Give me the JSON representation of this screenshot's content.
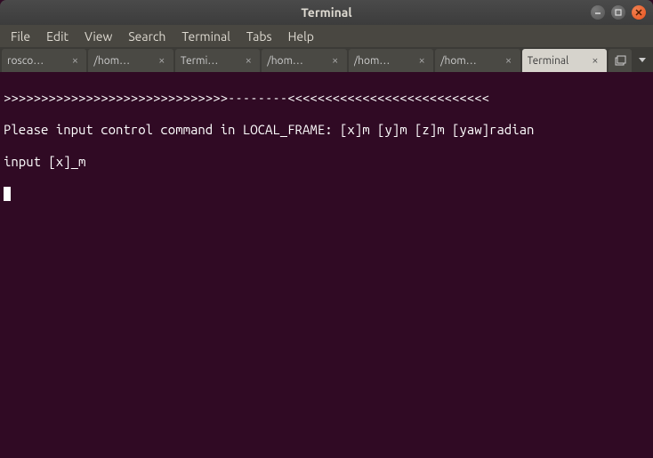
{
  "titlebar": {
    "title": "Terminal"
  },
  "menubar": {
    "items": [
      {
        "label": "File"
      },
      {
        "label": "Edit"
      },
      {
        "label": "View"
      },
      {
        "label": "Search"
      },
      {
        "label": "Terminal"
      },
      {
        "label": "Tabs"
      },
      {
        "label": "Help"
      }
    ]
  },
  "tabs": {
    "items": [
      {
        "label": "rosco…",
        "active": false
      },
      {
        "label": "/hom…",
        "active": false
      },
      {
        "label": "Termi…",
        "active": false
      },
      {
        "label": "/hom…",
        "active": false
      },
      {
        "label": "/hom…",
        "active": false
      },
      {
        "label": "/hom…",
        "active": false
      },
      {
        "label": "Terminal",
        "active": true
      }
    ]
  },
  "terminal": {
    "lines": [
      ">>>>>>>>>>>>>>>>>>>>>>>>>>>>>>--------<<<<<<<<<<<<<<<<<<<<<<<<<<<",
      "Please input control command in LOCAL_FRAME: [x]m [y]m [z]m [yaw]radian",
      "input [x]_m"
    ]
  }
}
